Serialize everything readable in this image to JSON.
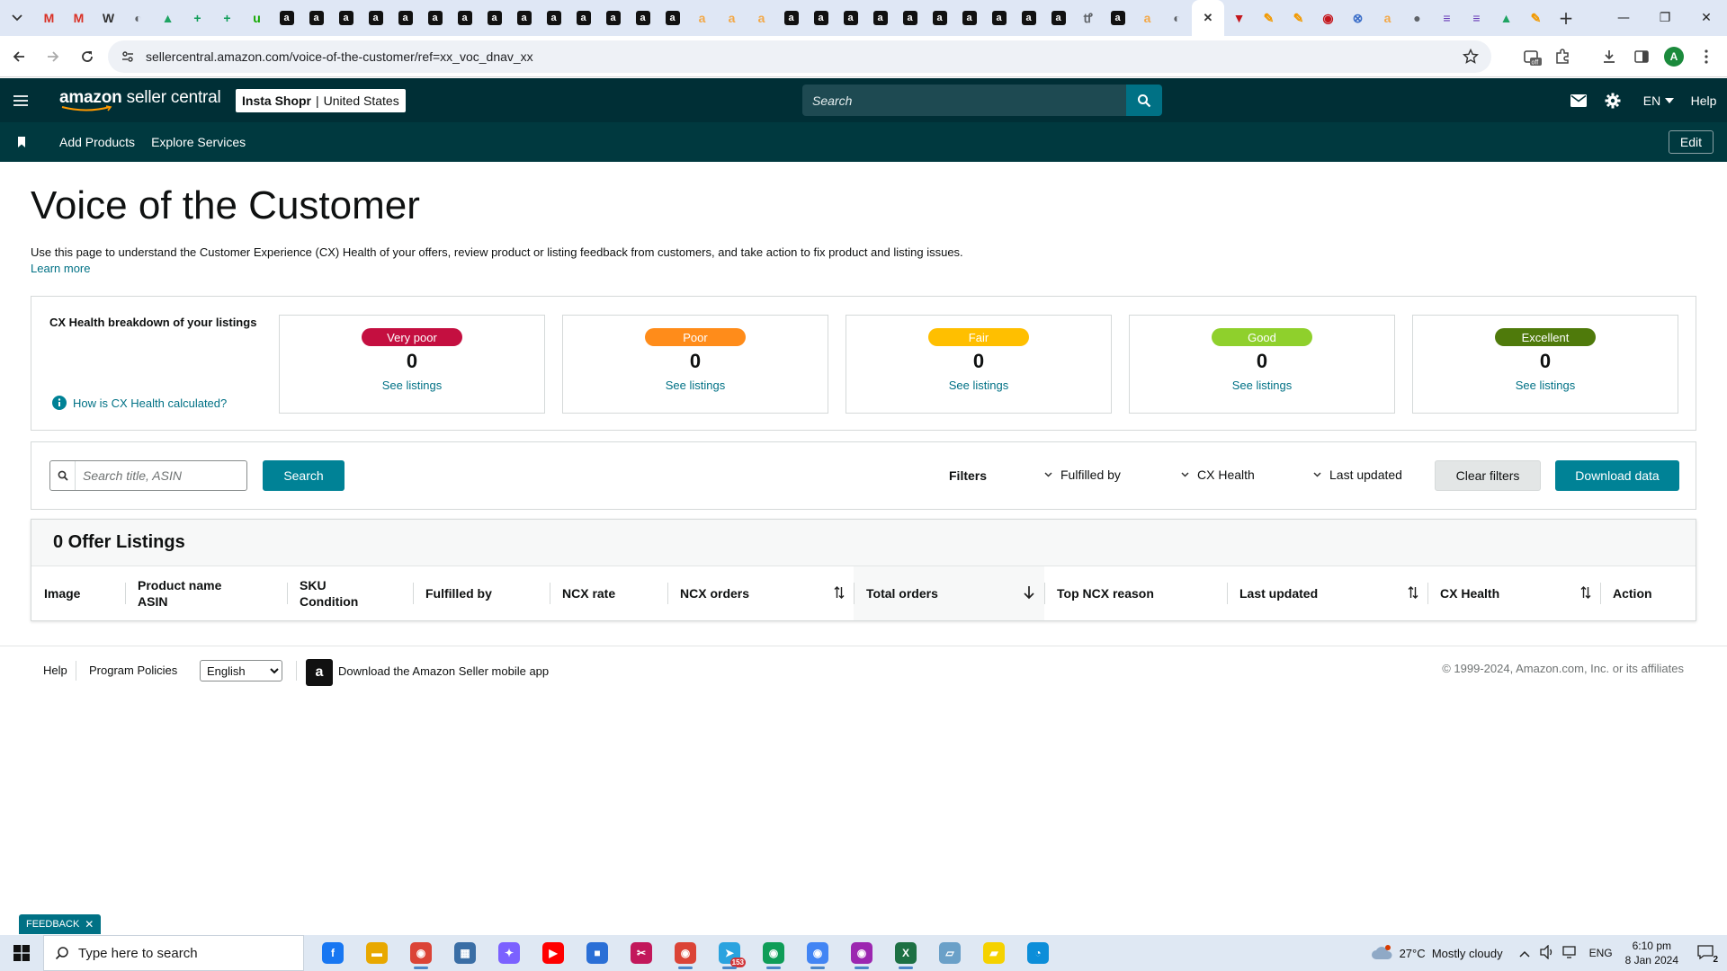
{
  "browser": {
    "url": "sellercentral.amazon.com/voice-of-the-customer/ref=xx_voc_dnav_xx",
    "tabs": [
      {
        "icon": "gmail-icon",
        "glyph": "M",
        "color": "#d93025"
      },
      {
        "icon": "gmail-icon",
        "glyph": "M",
        "color": "#d93025"
      },
      {
        "icon": "wix-icon",
        "glyph": "W",
        "color": "#333333"
      },
      {
        "icon": "globe-icon",
        "glyph": "◐",
        "color": "#5f6368"
      },
      {
        "icon": "drive-icon",
        "glyph": "▲",
        "color": "#1fa463"
      },
      {
        "icon": "sheets-plus-icon",
        "glyph": "+",
        "color": "#0f9d58"
      },
      {
        "icon": "sheets-plus-icon",
        "glyph": "+",
        "color": "#0f9d58"
      },
      {
        "icon": "upwork-icon",
        "glyph": "u",
        "color": "#14a800"
      },
      {
        "icon": "amazon-icon",
        "glyph": "a",
        "color": "#111111"
      },
      {
        "icon": "amazon-icon",
        "glyph": "a",
        "color": "#111111"
      },
      {
        "icon": "amazon-icon",
        "glyph": "a",
        "color": "#111111"
      },
      {
        "icon": "amazon-icon",
        "glyph": "a",
        "color": "#111111"
      },
      {
        "icon": "amazon-icon",
        "glyph": "a",
        "color": "#111111"
      },
      {
        "icon": "amazon-icon",
        "glyph": "a",
        "color": "#111111"
      },
      {
        "icon": "amazon-icon",
        "glyph": "a",
        "color": "#111111"
      },
      {
        "icon": "amazon-icon",
        "glyph": "a",
        "color": "#111111"
      },
      {
        "icon": "amazon-icon",
        "glyph": "a",
        "color": "#111111"
      },
      {
        "icon": "amazon-icon",
        "glyph": "a",
        "color": "#111111"
      },
      {
        "icon": "amazon-icon",
        "glyph": "a",
        "color": "#111111"
      },
      {
        "icon": "amazon-icon",
        "glyph": "a",
        "color": "#111111"
      },
      {
        "icon": "amazon-icon",
        "glyph": "a",
        "color": "#111111"
      },
      {
        "icon": "amazon-icon",
        "glyph": "a",
        "color": "#111111"
      },
      {
        "icon": "amazon-smile-icon",
        "glyph": "a",
        "color": "#f3a847"
      },
      {
        "icon": "amazon-smile-icon",
        "glyph": "a",
        "color": "#f3a847"
      },
      {
        "icon": "amazon-smile-icon",
        "glyph": "a",
        "color": "#f3a847"
      },
      {
        "icon": "amazon-icon",
        "glyph": "a",
        "color": "#111111"
      },
      {
        "icon": "amazon-icon",
        "glyph": "a",
        "color": "#111111"
      },
      {
        "icon": "amazon-icon",
        "glyph": "a",
        "color": "#111111"
      },
      {
        "icon": "amazon-icon",
        "glyph": "a",
        "color": "#111111"
      },
      {
        "icon": "amazon-icon",
        "glyph": "a",
        "color": "#111111"
      },
      {
        "icon": "amazon-icon",
        "glyph": "a",
        "color": "#111111"
      },
      {
        "icon": "amazon-icon",
        "glyph": "a",
        "color": "#111111"
      },
      {
        "icon": "amazon-icon",
        "glyph": "a",
        "color": "#111111"
      },
      {
        "icon": "amazon-icon",
        "glyph": "a",
        "color": "#111111"
      },
      {
        "icon": "amazon-icon",
        "glyph": "a",
        "color": "#111111"
      },
      {
        "icon": "tool-icon",
        "glyph": "ꝷ",
        "color": "#5f6368"
      },
      {
        "icon": "amazon-icon",
        "glyph": "a",
        "color": "#111111"
      },
      {
        "icon": "amazon-smile-icon",
        "glyph": "a",
        "color": "#f3a847"
      },
      {
        "icon": "globe-icon",
        "glyph": "◐",
        "color": "#5f6368"
      },
      {
        "icon": "close-tab-icon",
        "glyph": "✕",
        "color": "#333333",
        "active": true
      },
      {
        "icon": "vivaldi-icon",
        "glyph": "▼",
        "color": "#c4161c"
      },
      {
        "icon": "pencil-icon",
        "glyph": "✎",
        "color": "#f29900"
      },
      {
        "icon": "pencil-icon",
        "glyph": "✎",
        "color": "#f29900"
      },
      {
        "icon": "record-icon",
        "glyph": "◉",
        "color": "#c4161c"
      },
      {
        "icon": "link-icon",
        "glyph": "⊗",
        "color": "#3c6fc9"
      },
      {
        "icon": "amazon-smile-icon",
        "glyph": "a",
        "color": "#f3a847"
      },
      {
        "icon": "github-icon",
        "glyph": "●",
        "color": "#5f6368"
      },
      {
        "icon": "forms-icon",
        "glyph": "≡",
        "color": "#673ab7"
      },
      {
        "icon": "forms-icon",
        "glyph": "≡",
        "color": "#673ab7"
      },
      {
        "icon": "drive-icon",
        "glyph": "▲",
        "color": "#1fa463"
      },
      {
        "icon": "pencil-icon",
        "glyph": "✎",
        "color": "#f29900"
      }
    ],
    "profile_initial": "A"
  },
  "header": {
    "logo_brand": "amazon",
    "logo_product": "seller central",
    "store_name": "Insta Shopr",
    "store_region": "United States",
    "search_placeholder": "Search",
    "language": "EN",
    "help": "Help"
  },
  "subnav": {
    "links": [
      "Add Products",
      "Explore Services"
    ],
    "edit": "Edit"
  },
  "page": {
    "title": "Voice of the Customer",
    "description": "Use this page to understand the Customer Experience (CX) Health of your offers, review product or listing feedback from customers, and take action to fix product and listing issues.",
    "learn_more": "Learn more"
  },
  "cx_health": {
    "heading": "CX Health breakdown of your listings",
    "how_link": "How is CX Health calculated?",
    "cards": [
      {
        "label": "Very poor",
        "count": "0",
        "link": "See listings",
        "color": "#c40f40"
      },
      {
        "label": "Poor",
        "count": "0",
        "link": "See listings",
        "color": "#ff8c1a"
      },
      {
        "label": "Fair",
        "count": "0",
        "link": "See listings",
        "color": "#ffbf00"
      },
      {
        "label": "Good",
        "count": "0",
        "link": "See listings",
        "color": "#8fd02c"
      },
      {
        "label": "Excellent",
        "count": "0",
        "link": "See listings",
        "color": "#4f7a0b"
      }
    ]
  },
  "filters": {
    "search_placeholder": "Search title, ASIN",
    "search_button": "Search",
    "filters_label": "Filters",
    "dropdowns": [
      "Fulfilled by",
      "CX Health",
      "Last updated"
    ],
    "clear": "Clear filters",
    "download": "Download data"
  },
  "listings": {
    "title": "0 Offer Listings",
    "columns": [
      {
        "lines": [
          "Image"
        ]
      },
      {
        "lines": [
          "Product name",
          "ASIN"
        ]
      },
      {
        "lines": [
          "SKU",
          "Condition"
        ]
      },
      {
        "lines": [
          "Fulfilled by"
        ]
      },
      {
        "lines": [
          "NCX rate"
        ]
      },
      {
        "lines": [
          "NCX orders"
        ],
        "sort": "both"
      },
      {
        "lines": [
          "Total orders"
        ],
        "sort": "desc"
      },
      {
        "lines": [
          "Top NCX reason"
        ]
      },
      {
        "lines": [
          "Last updated"
        ],
        "sort": "both"
      },
      {
        "lines": [
          "CX Health"
        ],
        "sort": "both"
      },
      {
        "lines": [
          "Action"
        ]
      }
    ]
  },
  "footer": {
    "links": [
      "Help",
      "Program Policies"
    ],
    "language_options": [
      "English"
    ],
    "app_link": "Download the Amazon Seller mobile app",
    "copyright": "© 1999-2024, Amazon.com, Inc. or its affiliates"
  },
  "feedback": "FEEDBACK",
  "taskbar": {
    "search_placeholder": "Type here to search",
    "apps": [
      {
        "icon": "facebook-icon",
        "glyph": "f",
        "color": "#1877f2"
      },
      {
        "icon": "file-explorer-icon",
        "glyph": "▬",
        "color": "#e8a800"
      },
      {
        "icon": "chrome-icon",
        "glyph": "◉",
        "color": "#db4437",
        "running": true
      },
      {
        "icon": "calculator-icon",
        "glyph": "▦",
        "color": "#3a6ea5"
      },
      {
        "icon": "copilot-icon",
        "glyph": "✦",
        "color": "#7b61ff"
      },
      {
        "icon": "youtube-icon",
        "glyph": "▶",
        "color": "#ff0000"
      },
      {
        "icon": "store-icon",
        "glyph": "■",
        "color": "#2a6fd6"
      },
      {
        "icon": "snipping-tool-icon",
        "glyph": "✂",
        "color": "#c2185b"
      },
      {
        "icon": "chrome-profile-icon",
        "glyph": "◉",
        "color": "#db4437",
        "running": true
      },
      {
        "icon": "telegram-icon",
        "glyph": "➤",
        "color": "#2aa3df",
        "running": true
      },
      {
        "icon": "chrome-profile-icon",
        "glyph": "◉",
        "color": "#0f9d58",
        "running": true
      },
      {
        "icon": "chrome-profile-icon",
        "glyph": "◉",
        "color": "#4285f4",
        "running": true
      },
      {
        "icon": "chrome-profile-icon",
        "glyph": "◉",
        "color": "#9c27b0",
        "running": true
      },
      {
        "icon": "excel-icon",
        "glyph": "X",
        "color": "#1d7044",
        "running": true
      },
      {
        "icon": "folder-icon",
        "glyph": "▱",
        "color": "#6aa0c8"
      },
      {
        "icon": "sticky-notes-icon",
        "glyph": "▰",
        "color": "#f5d200"
      },
      {
        "icon": "edge-icon",
        "glyph": "◔",
        "color": "#0c8ed9"
      }
    ],
    "telegram_badge": "153",
    "temperature": "27°C",
    "weather": "Mostly cloudy",
    "input_lang": "ENG",
    "time": "6:10 pm",
    "date": "8 Jan 2024",
    "notifications": "2"
  }
}
